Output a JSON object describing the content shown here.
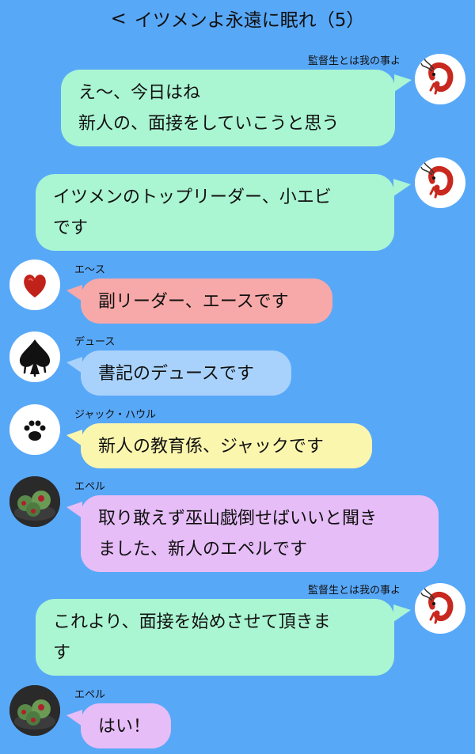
{
  "header": {
    "back_label": "<",
    "title": "イツメンよ永遠に眠れ（5）"
  },
  "messages": [
    {
      "sender": "監督生とは我の事よ",
      "lines": [
        "え〜、今日はね",
        "新人の、面接をしていこうと思う"
      ]
    },
    {
      "sender": "",
      "lines": [
        "イツメンのトップリーダー、小エビ",
        "です"
      ]
    },
    {
      "sender": "エ〜ス",
      "lines": [
        "副リーダー、エースです"
      ]
    },
    {
      "sender": "デュース",
      "lines": [
        "書記のデュースです"
      ]
    },
    {
      "sender": "ジャック・ハウル",
      "lines": [
        "新人の教育係、ジャックです"
      ]
    },
    {
      "sender": "エペル",
      "lines": [
        "取り敢えず巫山戯倒せばいいと聞き",
        "ました、新人のエペルです"
      ]
    },
    {
      "sender": "監督生とは我の事よ",
      "lines": [
        "これより、面接を始めさせて頂きま",
        "す"
      ]
    },
    {
      "sender": "エペル",
      "lines": [
        "はい！"
      ]
    }
  ],
  "colors": {
    "background": "#58a8f8",
    "kantokusei_bubble": "#aaf5d2",
    "ace_bubble": "#f7a8a8",
    "deuce_bubble": "#a8d2fb",
    "jack_bubble": "#fbf6ae",
    "epel_bubble": "#e7bdf8"
  },
  "avatars": {
    "kantokusei": "shrimp-icon",
    "ace": "heart-icon",
    "deuce": "spade-icon",
    "jack": "paw-icon",
    "epel": "poison-apple-icon"
  }
}
